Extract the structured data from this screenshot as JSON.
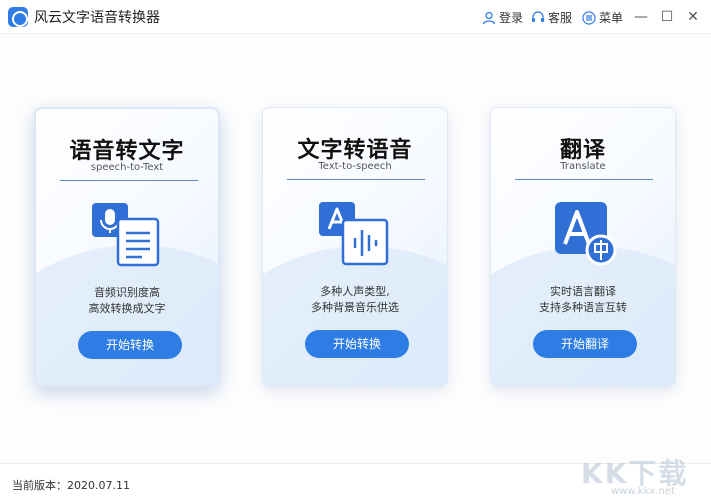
{
  "window": {
    "title": "风云文字语音转换器",
    "login_label": "登录",
    "service_label": "客服",
    "menu_label": "菜单",
    "minimize_glyph": "—",
    "maximize_glyph": "☐",
    "close_glyph": "✕"
  },
  "cards": [
    {
      "title": "语音转文字",
      "subtitle": "speech-to-Text",
      "desc_line1": "音频识别度高",
      "desc_line2": "高效转换成文字",
      "button": "开始转换",
      "icon": "mic-to-text-icon"
    },
    {
      "title": "文字转语音",
      "subtitle": "Text-to-speech",
      "desc_line1": "多种人声类型,",
      "desc_line2": "多种背景音乐供选",
      "button": "开始转换",
      "icon": "text-to-speech-icon"
    },
    {
      "title": "翻译",
      "subtitle": "Translate",
      "desc_line1": "实时语言翻译",
      "desc_line2": "支持多种语言互转",
      "button": "开始翻译",
      "icon": "translate-icon"
    }
  ],
  "footer": {
    "version_label": "当前版本：2020.07.11"
  },
  "watermark": {
    "logo": "KK下载",
    "url": "www.kkx.net"
  },
  "colors": {
    "accent": "#2e7de4",
    "icon_blue": "#2f6fd6"
  }
}
